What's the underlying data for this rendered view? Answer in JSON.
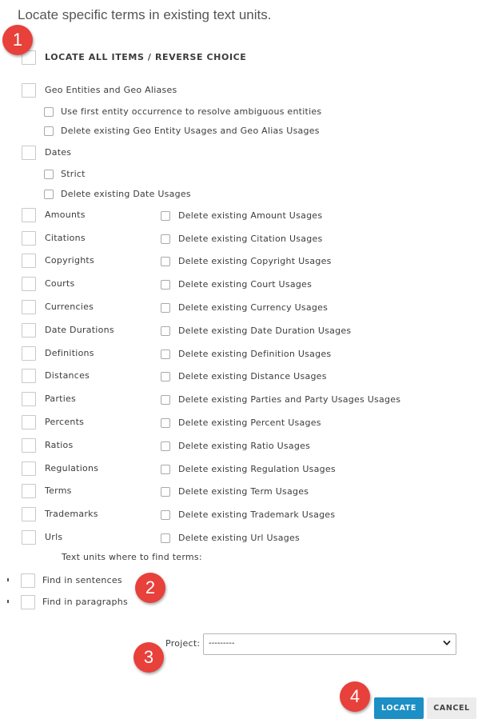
{
  "header": {
    "subtitle": "Locate specific terms in existing text units."
  },
  "locate_all_label": "LOCATE ALL ITEMS / REVERSE CHOICE",
  "geo": {
    "label": "Geo Entities and Geo Aliases",
    "options": [
      "Use first entity occurrence to resolve ambiguous entities",
      "Delete existing Geo Entity Usages and Geo Alias Usages"
    ]
  },
  "dates": {
    "label": "Dates",
    "options": [
      "Strict",
      "Delete existing Date Usages"
    ]
  },
  "items": [
    {
      "label": "Amounts",
      "delete": "Delete existing Amount Usages"
    },
    {
      "label": "Citations",
      "delete": "Delete existing Citation Usages"
    },
    {
      "label": "Copyrights",
      "delete": "Delete existing Copyright Usages"
    },
    {
      "label": "Courts",
      "delete": "Delete existing Court Usages"
    },
    {
      "label": "Currencies",
      "delete": "Delete existing Currency Usages"
    },
    {
      "label": "Date Durations",
      "delete": "Delete existing Date Duration Usages"
    },
    {
      "label": "Definitions",
      "delete": "Delete existing Definition Usages"
    },
    {
      "label": "Distances",
      "delete": "Delete existing Distance Usages"
    },
    {
      "label": "Parties",
      "delete": "Delete existing Parties and Party Usages Usages"
    },
    {
      "label": "Percents",
      "delete": "Delete existing Percent Usages"
    },
    {
      "label": "Ratios",
      "delete": "Delete existing Ratio Usages"
    },
    {
      "label": "Regulations",
      "delete": "Delete existing Regulation Usages"
    },
    {
      "label": "Terms",
      "delete": "Delete existing Term Usages"
    },
    {
      "label": "Trademarks",
      "delete": "Delete existing Trademark Usages"
    },
    {
      "label": "Urls",
      "delete": "Delete existing Url Usages"
    }
  ],
  "text_units": {
    "label": "Text units where to find terms:",
    "options": [
      "Find in sentences",
      "Find in paragraphs"
    ]
  },
  "project": {
    "label": "Project:",
    "value": "---------"
  },
  "buttons": {
    "locate": "LOCATE",
    "cancel": "CANCEL"
  },
  "markers": [
    "1",
    "2",
    "3",
    "4"
  ],
  "colors": {
    "accent": "#1c8fc4",
    "marker": "#e8403a",
    "cancel_bg": "#ececec"
  },
  "icons": {
    "select_arrow": "chevron-down-icon"
  }
}
